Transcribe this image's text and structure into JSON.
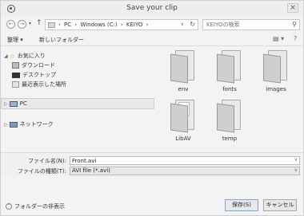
{
  "window": {
    "title": "Save your clip",
    "close": "×"
  },
  "nav": {
    "back": "←",
    "forward": "→",
    "up": "↑"
  },
  "address": {
    "crumbs": [
      "PC",
      "Windows (C:)",
      "KEIYO"
    ],
    "separator": "›"
  },
  "search": {
    "placeholder": "KEIYOの検索"
  },
  "toolbar": {
    "organize": "整理 ▾",
    "new_folder": "新しいフォルダー",
    "view": "▤ ▾",
    "help": "?"
  },
  "sidebar": {
    "favorites": "お気に入り",
    "downloads": "ダウンロード",
    "desktop": "デスクトップ",
    "recent": "最近表示した場所",
    "pc": "PC",
    "network": "ネットワーク"
  },
  "files": [
    {
      "name": "env"
    },
    {
      "name": "fonts"
    },
    {
      "name": "images"
    },
    {
      "name": "LibAV"
    },
    {
      "name": "temp"
    }
  ],
  "form": {
    "filename_label": "ファイル名(N):",
    "filename_value": "Front.avi",
    "filetype_label": "ファイルの種類(T):",
    "filetype_value": "AVI file (*.avi)"
  },
  "footer": {
    "hide_folders": "フォルダーの非表示",
    "save": "保存(S)",
    "cancel": "キャンセル"
  }
}
